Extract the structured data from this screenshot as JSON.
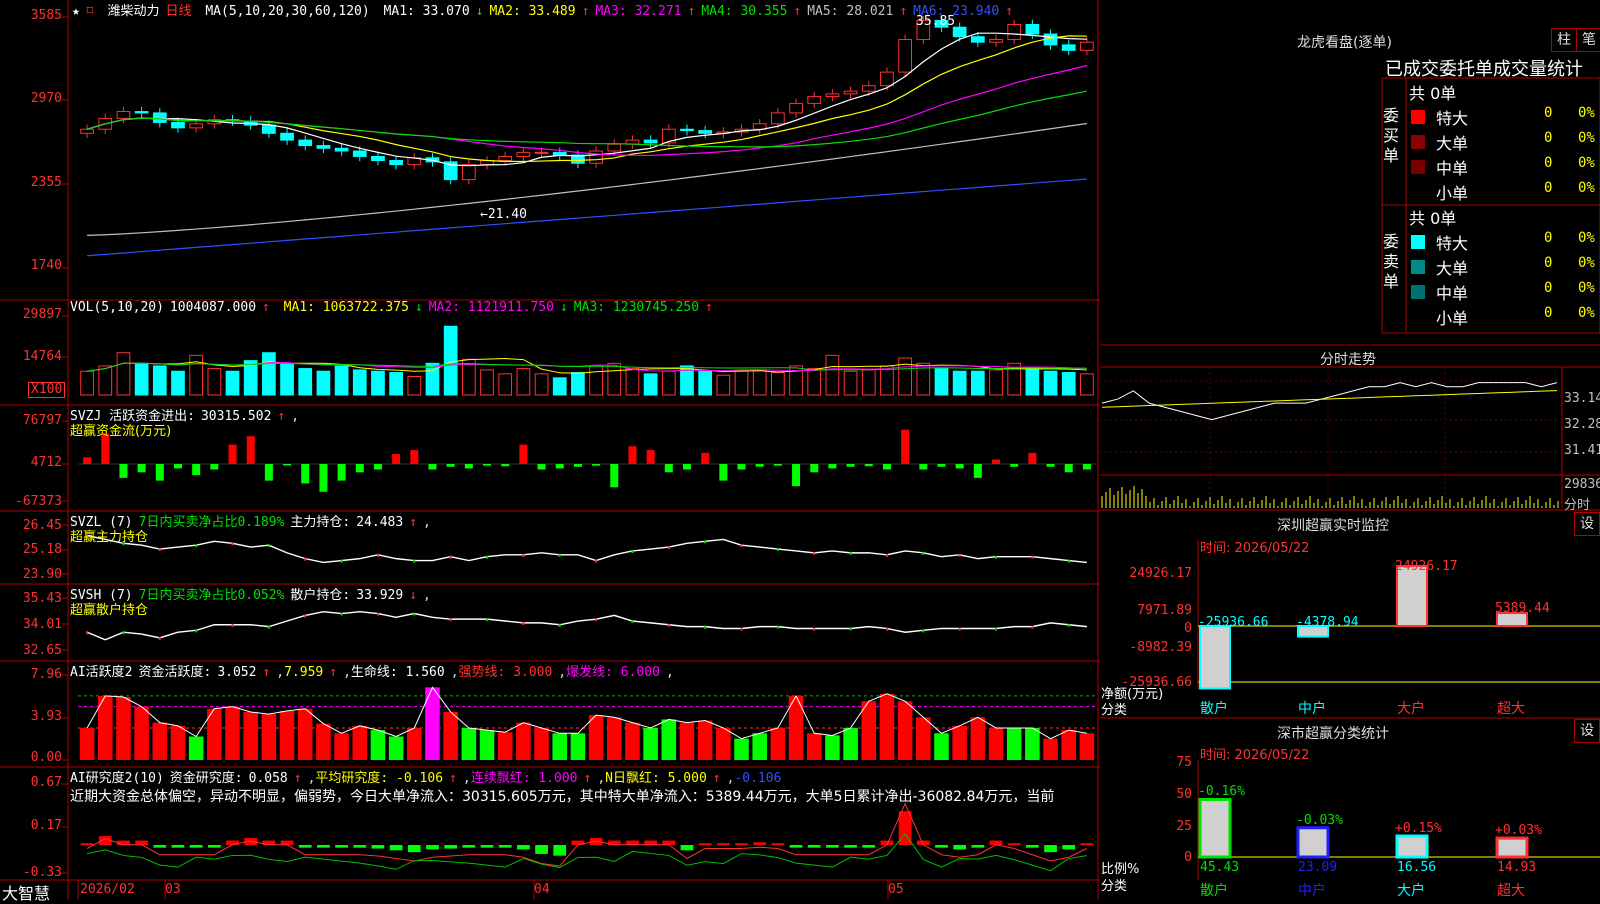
{
  "stock": {
    "name": "潍柴动力",
    "period": "日线",
    "star": "★",
    "flag": "⌑"
  },
  "price_legend": {
    "params": "MA(5,10,20,30,60,120)",
    "items": [
      {
        "text": "MA1: 33.070",
        "arrow": "↓",
        "color": "#ffffff"
      },
      {
        "text": "MA2: 33.489",
        "arrow": "↑",
        "color": "#ffff00"
      },
      {
        "text": "MA3: 32.271",
        "arrow": "↑",
        "color": "#ff00ff"
      },
      {
        "text": "MA4: 30.355",
        "arrow": "↑",
        "color": "#00e000"
      },
      {
        "text": "MA5: 28.021",
        "arrow": "↑",
        "color": "#c0c0c0"
      },
      {
        "text": "MA6: 23.940",
        "arrow": "↑",
        "color": "#3050ff"
      }
    ],
    "high_label": "35.85",
    "low_label": "←21.40"
  },
  "price_axis": [
    "3585",
    "2970",
    "2355",
    "1740"
  ],
  "vol_legend": {
    "title": "VOL(5,10,20)",
    "value": "1004087.000",
    "items": [
      {
        "text": "MA1: 1063722.375",
        "arrow": "↓",
        "color": "#ffff00"
      },
      {
        "text": "MA2: 1121911.750",
        "arrow": "↓",
        "color": "#ff00ff"
      },
      {
        "text": "MA3: 1230745.250",
        "arrow": "↑",
        "color": "#00e000"
      }
    ]
  },
  "vol_axis": [
    "29897",
    "14764",
    "X100"
  ],
  "svzj": {
    "title": "SVZJ  活跃资金进出:",
    "value": "30315.502",
    "sub": "超赢资金流(万元)",
    "axis": [
      "76797",
      "4712",
      "-67373"
    ]
  },
  "svzl": {
    "title": "SVZL (7)",
    "pct": "7日内买卖净占比0.189%",
    "label": "主力持仓:",
    "value": "24.483",
    "sub": "超赢主力持仓",
    "axis": [
      "26.45",
      "25.18",
      "23.90"
    ]
  },
  "svsh": {
    "title": "SVSH (7)",
    "pct": "7日内买卖净占比0.052%",
    "label": "散户持仓:",
    "value": "33.929",
    "sub": "超赢散户持仓",
    "axis": [
      "35.43",
      "34.01",
      "32.65"
    ]
  },
  "ai_active": {
    "title": "AI活跃度2",
    "label": "资金活跃度:",
    "value": "3.052",
    "v2": "7.959",
    "life": "生命线: 1.560",
    "strong": "强势线: 3.000",
    "burst": "爆发线: 6.000",
    "axis": [
      "7.96",
      "3.93",
      "0.00"
    ]
  },
  "ai_research": {
    "title": "AI研究度2(10)",
    "label": "资金研究度:",
    "value": "0.058",
    "avg": "平均研究度: -0.106",
    "cont": "连续飘红: 1.000",
    "nday": "N日飘红: 5.000",
    "last": "-0.106",
    "axis": [
      "0.67",
      "0.17",
      "-0.33"
    ]
  },
  "commentary": "近期大资金总体偏空，异动不明显，偏弱势，今日大单净流入：30315.605万元，其中特大单净流入：5389.44万元，大单5日累计净出-36082.84万元，当前",
  "x_axis": {
    "brand": "大智慧",
    "labels": [
      "2026/02",
      "03",
      "04",
      "05"
    ]
  },
  "right": {
    "dragon_title": "龙虎看盘(逐单)",
    "btn1": "柱",
    "btn2": "笔",
    "stats_title": "已成交委托单成交量统计",
    "buy": {
      "side": "委买单",
      "total": "共 0单",
      "rows": [
        {
          "label": "特大",
          "n": "0",
          "pct": "0%",
          "color": "#ff0000"
        },
        {
          "label": "大单",
          "n": "0",
          "pct": "0%",
          "color": "#8b0000"
        },
        {
          "label": "中单",
          "n": "0",
          "pct": "0%",
          "color": "#7a0000"
        },
        {
          "label": "小单",
          "n": "0",
          "pct": "0%",
          "color": ""
        }
      ]
    },
    "sell": {
      "side": "委卖单",
      "total": "共 0单",
      "rows": [
        {
          "label": "特大",
          "n": "0",
          "pct": "0%",
          "color": "#00ffff"
        },
        {
          "label": "大单",
          "n": "0",
          "pct": "0%",
          "color": "#008b8b"
        },
        {
          "label": "中单",
          "n": "0",
          "pct": "0%",
          "color": "#007070"
        },
        {
          "label": "小单",
          "n": "0",
          "pct": "0%",
          "color": ""
        }
      ]
    },
    "intraday_title": "分时走势",
    "intraday_axis": [
      "33.14",
      "32.28",
      "31.41",
      "29836",
      "分时"
    ],
    "sz_title": "深圳超赢实时监控",
    "sz_btn": "设",
    "sz_time": "时间: 2026/05/22",
    "sz_axis": [
      "24926.17",
      "7971.89",
      "0",
      "-8982.39",
      "-25936.66"
    ],
    "sz_ylabel": "净额(万元)",
    "sz_xlabel": "分类",
    "sz_value_labels": [
      "-25936.66",
      "-4378.94",
      "24926.17",
      "5389.44"
    ],
    "cat_title": "深市超赢分类统计",
    "cat_btn": "设",
    "cat_time": "时间: 2026/05/22",
    "cat_axis": [
      "75",
      "50",
      "25",
      "0"
    ],
    "cat_ylabel": "比例%",
    "cat_xlabel": "分类",
    "cat_top_labels": [
      "-0.16%",
      "-0.03%",
      "+0.15%",
      "+0.03%"
    ],
    "cat_bottom_labels": [
      "45.43",
      "23.09",
      "16.56",
      "14.93"
    ],
    "categories": [
      "散户",
      "中户",
      "大户",
      "超大"
    ]
  },
  "chart_data": [
    {
      "type": "candlestick",
      "title": "潍柴动力 日线",
      "ylim": [
        17.4,
        35.85
      ],
      "yticks": [
        35.85,
        29.7,
        23.55,
        17.4
      ],
      "high": 35.85,
      "low": 21.4,
      "ma_last": {
        "MA1": 33.07,
        "MA2": 33.489,
        "MA3": 32.271,
        "MA4": 30.355,
        "MA5": 28.021,
        "MA6": 23.94
      },
      "x_labels": [
        "2026/02",
        "03",
        "04",
        "05"
      ],
      "close": [
        27.6,
        28.4,
        28.9,
        28.8,
        28.1,
        27.7,
        28.0,
        28.3,
        28.2,
        27.9,
        27.3,
        26.8,
        26.4,
        26.2,
        26.0,
        25.6,
        25.3,
        25.0,
        25.5,
        25.2,
        23.9,
        25.0,
        25.3,
        25.6,
        25.9,
        25.9,
        25.7,
        25.1,
        26.0,
        26.5,
        26.8,
        26.6,
        27.6,
        27.5,
        27.3,
        27.4,
        27.6,
        28.0,
        28.8,
        29.5,
        30.0,
        30.2,
        30.4,
        30.8,
        31.8,
        34.2,
        35.6,
        35.1,
        34.4,
        34.0,
        34.2,
        35.3,
        34.6,
        33.8,
        33.4,
        34.0
      ]
    },
    {
      "type": "bar",
      "title": "VOL(5,10,20)",
      "ylim": [
        0,
        29897
      ],
      "unit": "X100",
      "last": 1004087.0,
      "values": [
        9000,
        11000,
        16000,
        12000,
        11000,
        9000,
        15000,
        10000,
        9000,
        13000,
        16000,
        12000,
        10000,
        9000,
        11000,
        9500,
        9000,
        8500,
        7000,
        12000,
        26000,
        13500,
        9500,
        8000,
        10000,
        8000,
        6500,
        8500,
        11000,
        12000,
        10000,
        8000,
        9000,
        11000,
        9000,
        7500,
        9000,
        9500,
        8500,
        11000,
        10000,
        15000,
        9000,
        9500,
        11000,
        14000,
        12000,
        10000,
        9000,
        9000,
        9500,
        12000,
        10000,
        9000,
        8500,
        8000
      ]
    },
    {
      "type": "bar",
      "title": "SVZJ 活跃资金进出",
      "ylim": [
        -67373,
        76797
      ],
      "last": 30315.502,
      "values": [
        12000,
        55000,
        -25000,
        -15000,
        -30000,
        -8000,
        -20000,
        -10000,
        35000,
        50000,
        -30000,
        -2000,
        -35000,
        -50000,
        -30000,
        -15000,
        -10000,
        18000,
        25000,
        -10000,
        -5000,
        -8000,
        -3000,
        -4000,
        35000,
        -10000,
        -8000,
        -5000,
        -3000,
        -42000,
        32000,
        25000,
        -15000,
        -10000,
        20000,
        -30000,
        -10000,
        -5000,
        -3000,
        -40000,
        -15000,
        -8000,
        -5000,
        -4000,
        -10000,
        62000,
        -10000,
        -5000,
        -8000,
        -25000,
        8000,
        -5000,
        20000,
        -5000,
        -15000,
        -10000,
        30000
      ]
    },
    {
      "type": "line",
      "title": "SVZL 主力持仓",
      "ylim": [
        23.9,
        26.45
      ],
      "last": 24.483,
      "values": [
        25.9,
        25.7,
        25.5,
        25.4,
        25.2,
        25.3,
        25.4,
        25.6,
        25.5,
        25.3,
        25.4,
        25.0,
        24.7,
        24.5,
        24.6,
        24.7,
        24.9,
        24.7,
        24.6,
        24.6,
        24.8,
        24.6,
        24.8,
        24.9,
        24.9,
        25.0,
        24.9,
        24.9,
        24.6,
        24.9,
        25.1,
        25.2,
        25.3,
        25.5,
        25.6,
        25.7,
        25.4,
        25.3,
        25.2,
        25.1,
        25.0,
        25.1,
        25.0,
        25.0,
        24.9,
        25.1,
        25.0,
        24.8,
        24.9,
        24.7,
        24.8,
        24.8,
        24.8,
        24.7,
        24.6,
        24.5
      ]
    },
    {
      "type": "line",
      "title": "SVSH 散户持仓",
      "ylim": [
        32.65,
        35.43
      ],
      "last": 33.929,
      "values": [
        33.6,
        33.2,
        33.6,
        33.5,
        33.3,
        33.6,
        33.7,
        34.0,
        34.0,
        34.0,
        33.9,
        34.2,
        34.5,
        34.7,
        34.6,
        34.7,
        34.6,
        34.4,
        34.6,
        34.4,
        34.3,
        34.3,
        34.3,
        34.2,
        34.1,
        34.1,
        34.0,
        34.2,
        34.3,
        34.5,
        34.2,
        34.1,
        34.0,
        33.9,
        33.9,
        33.8,
        33.8,
        33.9,
        33.9,
        33.8,
        33.8,
        33.8,
        33.8,
        33.9,
        33.8,
        33.6,
        33.7,
        33.8,
        33.8,
        33.8,
        33.8,
        33.9,
        33.9,
        34.1,
        34.0,
        33.9
      ]
    },
    {
      "type": "bar",
      "title": "AI活跃度2",
      "ylim": [
        0,
        7.96
      ],
      "last": 3.052,
      "values": [
        3.0,
        6.0,
        5.9,
        5.0,
        3.5,
        3.2,
        2.2,
        4.8,
        5.0,
        4.5,
        4.3,
        4.6,
        4.8,
        3.4,
        2.5,
        3.2,
        2.8,
        2.2,
        3.0,
        6.8,
        4.5,
        3.0,
        2.8,
        2.6,
        3.5,
        3.0,
        2.5,
        2.5,
        4.2,
        4.0,
        3.5,
        3.0,
        3.8,
        3.5,
        3.7,
        3.0,
        2.0,
        2.5,
        3.0,
        6.0,
        2.5,
        2.3,
        3.0,
        5.5,
        6.2,
        5.5,
        4.0,
        2.5,
        3.2,
        4.0,
        3.0,
        3.0,
        3.0,
        2.0,
        2.8,
        2.5,
        3.0
      ],
      "lines": {
        "生命线": 1.56,
        "强势线": 3.0,
        "爆发线": 6.0
      }
    },
    {
      "type": "bar",
      "title": "AI研究度2(10)",
      "ylim": [
        -0.33,
        0.67
      ],
      "last": 0.058,
      "values": [
        0.02,
        0.1,
        0.05,
        0.05,
        -0.03,
        -0.03,
        -0.03,
        -0.03,
        0.05,
        0.08,
        0.05,
        0.05,
        -0.03,
        -0.03,
        -0.03,
        -0.03,
        -0.04,
        -0.06,
        -0.08,
        -0.05,
        -0.04,
        -0.03,
        -0.03,
        -0.03,
        -0.05,
        -0.1,
        -0.12,
        0.05,
        0.08,
        0.05,
        0.05,
        0.05,
        0.05,
        -0.06,
        0.02,
        0.02,
        0.02,
        0.03,
        0.02,
        -0.03,
        -0.03,
        -0.03,
        -0.03,
        -0.03,
        0.05,
        0.38,
        0.05,
        -0.03,
        -0.05,
        -0.03,
        0.05,
        0.02,
        -0.03,
        -0.08,
        -0.05,
        0.02,
        0.06
      ]
    },
    {
      "type": "bar",
      "title": "深圳超赢实时监控",
      "ylabel": "净额(万元)",
      "xlabel": "分类",
      "categories": [
        "散户",
        "中户",
        "大户",
        "超大"
      ],
      "values": [
        -25936.66,
        -4378.94,
        24926.17,
        5389.44
      ],
      "ylim": [
        -25936.66,
        24926.17
      ]
    },
    {
      "type": "bar",
      "title": "深市超赢分类统计",
      "ylabel": "比例%",
      "xlabel": "分类",
      "categories": [
        "散户",
        "中户",
        "大户",
        "超大"
      ],
      "values": [
        45.43,
        23.09,
        16.56,
        14.93
      ],
      "changes": [
        "-0.16%",
        "-0.03%",
        "+0.15%",
        "+0.03%"
      ],
      "ylim": [
        0,
        75
      ]
    },
    {
      "type": "line",
      "title": "分时走势",
      "ylim": [
        31.41,
        33.14
      ],
      "yticks": [
        33.14,
        32.28,
        31.41
      ],
      "volume_label": "29836",
      "values": [
        32.6,
        32.7,
        32.9,
        32.6,
        32.5,
        32.4,
        32.3,
        32.2,
        32.3,
        32.4,
        32.5,
        32.6,
        32.6,
        32.6,
        32.7,
        32.8,
        32.9,
        33.0,
        33.0,
        33.1,
        33.0,
        33.1,
        33.0,
        33.0,
        33.1,
        33.1,
        33.1,
        33.1,
        33.0,
        33.1
      ]
    }
  ],
  "colors": {
    "up": "#ff3232",
    "down": "#00ffff",
    "grid": "#b00000",
    "bg": "#000000"
  }
}
